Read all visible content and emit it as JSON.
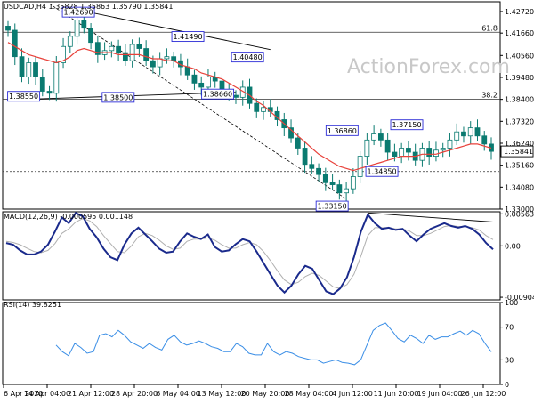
{
  "header": {
    "main_title": "USDCAD,H4  1.35828 1.35863 1.35790 1.35841",
    "macd_title": "MACD(12,26,9) -0.000595 0.001148",
    "rsi_title": "RSI(14) 39.8251"
  },
  "watermark": "ActionForex.com",
  "colors": {
    "candle": "#0a7a70",
    "ma": "#e8413a",
    "macd_line": "#1a2a8c",
    "macd_signal": "#b0b0b0",
    "rsi": "#3a8ee6",
    "trendline": "#000000",
    "label_border": "#2b2bd6",
    "grid": "#000000"
  },
  "chart_data": [
    {
      "type": "candlestick",
      "name": "USDCAD H4",
      "ylim": [
        1.33,
        1.432
      ],
      "y_ticks": [
        "1.42720",
        "1.41660",
        "1.40560",
        "1.39480",
        "1.38400",
        "1.37320",
        "1.36240",
        "1.35160",
        "1.34080",
        "1.33000"
      ],
      "x_ticks": [
        "6 Apr 2020",
        "14 Apr 04:00",
        "21 Apr 12:00",
        "28 Apr 20:00",
        "6 May 04:00",
        "13 May 12:00",
        "20 May 20:00",
        "28 May 04:00",
        "4 Jun 12:00",
        "11 Jun 20:00",
        "19 Jun 04:00",
        "26 Jun 12:00"
      ],
      "close_path": [
        1.418,
        1.405,
        1.395,
        1.402,
        1.395,
        1.388,
        1.387,
        1.402,
        1.41,
        1.415,
        1.423,
        1.419,
        1.412,
        1.406,
        1.408,
        1.41,
        1.407,
        1.403,
        1.411,
        1.409,
        1.403,
        1.4,
        1.404,
        1.405,
        1.403,
        1.4,
        1.396,
        1.392,
        1.39,
        1.395,
        1.393,
        1.388,
        1.386,
        1.385,
        1.39,
        1.382,
        1.378,
        1.38,
        1.378,
        1.374,
        1.37,
        1.365,
        1.36,
        1.352,
        1.35,
        1.347,
        1.343,
        1.342,
        1.338,
        1.34,
        1.346,
        1.356,
        1.364,
        1.367,
        1.364,
        1.358,
        1.356,
        1.36,
        1.358,
        1.354,
        1.36,
        1.356,
        1.359,
        1.36,
        1.364,
        1.368,
        1.366,
        1.37,
        1.366,
        1.362,
        1.3584
      ],
      "moving_average": [
        1.412,
        1.41,
        1.408,
        1.406,
        1.405,
        1.404,
        1.403,
        1.402,
        1.403,
        1.405,
        1.408,
        1.409,
        1.408,
        1.407,
        1.407,
        1.407,
        1.406,
        1.406,
        1.406,
        1.406,
        1.405,
        1.404,
        1.404,
        1.403,
        1.403,
        1.401,
        1.4,
        1.399,
        1.397,
        1.396,
        1.395,
        1.394,
        1.392,
        1.39,
        1.388,
        1.386,
        1.383,
        1.381,
        1.378,
        1.375,
        1.372,
        1.369,
        1.366,
        1.363,
        1.36,
        1.357,
        1.355,
        1.353,
        1.351,
        1.35,
        1.349,
        1.35,
        1.351,
        1.352,
        1.353,
        1.354,
        1.355,
        1.356,
        1.356,
        1.356,
        1.357,
        1.357,
        1.357,
        1.358,
        1.359,
        1.36,
        1.361,
        1.362,
        1.362,
        1.361,
        1.36
      ],
      "levels": [
        {
          "label": "61.8",
          "value": 1.417,
          "style": "solid"
        },
        {
          "label": "38.2",
          "value": 1.384,
          "style": "solid"
        },
        {
          "label": "",
          "value": 1.3485,
          "style": "dotted"
        }
      ],
      "price_marker": "1.35841",
      "annotations": [
        {
          "text": "1.42690",
          "x": 0.12,
          "y": 1.4269
        },
        {
          "text": "1.41490",
          "x": 0.34,
          "y": 1.4149
        },
        {
          "text": "1.40480",
          "x": 0.46,
          "y": 1.4048
        },
        {
          "text": "1.38550",
          "x": 0.01,
          "y": 1.3855
        },
        {
          "text": "1.38500",
          "x": 0.2,
          "y": 1.385
        },
        {
          "text": "1.38660",
          "x": 0.4,
          "y": 1.3866
        },
        {
          "text": "1.36860",
          "x": 0.65,
          "y": 1.3686
        },
        {
          "text": "1.37150",
          "x": 0.78,
          "y": 1.3715
        },
        {
          "text": "1.34850",
          "x": 0.73,
          "y": 1.3485
        },
        {
          "text": "1.33150",
          "x": 0.63,
          "y": 1.3315
        }
      ]
    },
    {
      "type": "line",
      "name": "MACD(12,26,9)",
      "ylim": [
        -0.0095,
        0.006
      ],
      "y_ticks": [
        "0.005632",
        "0.00",
        "-0.009041"
      ],
      "macd": [
        0.0005,
        0.0002,
        -0.0008,
        -0.0015,
        -0.0015,
        -0.001,
        0.0002,
        0.0025,
        0.005,
        0.004,
        0.0058,
        0.0052,
        0.003,
        0.0015,
        -0.0005,
        -0.002,
        -0.0025,
        0.0002,
        0.0022,
        0.0032,
        0.002,
        0.0008,
        -0.0005,
        -0.0012,
        -0.001,
        0.0008,
        0.0022,
        0.0016,
        0.0012,
        0.002,
        -0.0002,
        -0.001,
        -0.0008,
        0.0003,
        0.0012,
        0.0008,
        -0.001,
        -0.003,
        -0.005,
        -0.007,
        -0.0082,
        -0.007,
        -0.005,
        -0.0035,
        -0.004,
        -0.006,
        -0.008,
        -0.0085,
        -0.0075,
        -0.0055,
        -0.002,
        0.0025,
        0.0055,
        0.004,
        0.003,
        0.0032,
        0.0028,
        0.003,
        0.0018,
        0.0008,
        0.002,
        0.003,
        0.0035,
        0.004,
        0.0035,
        0.0032,
        0.0035,
        0.003,
        0.002,
        0.0005,
        -0.0006
      ],
      "signal": [
        0.0008,
        0.0006,
        0.0002,
        -0.0004,
        -0.001,
        -0.0012,
        -0.0008,
        0.0004,
        0.0022,
        0.003,
        0.0042,
        0.0048,
        0.0044,
        0.0034,
        0.0018,
        0.0004,
        -0.001,
        -0.0012,
        0.0,
        0.0016,
        0.0022,
        0.0018,
        0.001,
        0.0,
        -0.0006,
        -0.0004,
        0.0008,
        0.0012,
        0.0012,
        0.0014,
        0.001,
        0.0002,
        -0.0004,
        -0.0004,
        0.0002,
        0.0006,
        0.0002,
        -0.001,
        -0.0026,
        -0.0044,
        -0.006,
        -0.0068,
        -0.0064,
        -0.0054,
        -0.0048,
        -0.0052,
        -0.0062,
        -0.0072,
        -0.0075,
        -0.0068,
        -0.005,
        -0.0018,
        0.0018,
        0.0032,
        0.0032,
        0.0032,
        0.003,
        0.003,
        0.0026,
        0.0018,
        0.0018,
        0.0022,
        0.0028,
        0.0034,
        0.0036,
        0.0034,
        0.0034,
        0.0032,
        0.0028,
        0.0018,
        0.0011
      ]
    },
    {
      "type": "line",
      "name": "RSI(14)",
      "ylim": [
        0,
        100
      ],
      "y_ticks": [
        "100",
        "70",
        "30",
        "0"
      ],
      "values": [
        48,
        40,
        35,
        50,
        45,
        38,
        40,
        60,
        62,
        58,
        66,
        60,
        52,
        48,
        44,
        50,
        45,
        42,
        55,
        60,
        52,
        48,
        50,
        53,
        50,
        46,
        44,
        40,
        40,
        50,
        46,
        38,
        36,
        36,
        50,
        40,
        36,
        40,
        38,
        34,
        32,
        30,
        30,
        26,
        28,
        30,
        27,
        26,
        24,
        30,
        48,
        66,
        72,
        75,
        66,
        56,
        52,
        60,
        56,
        50,
        60,
        55,
        58,
        58,
        62,
        65,
        60,
        66,
        62,
        50,
        39.8
      ]
    }
  ]
}
